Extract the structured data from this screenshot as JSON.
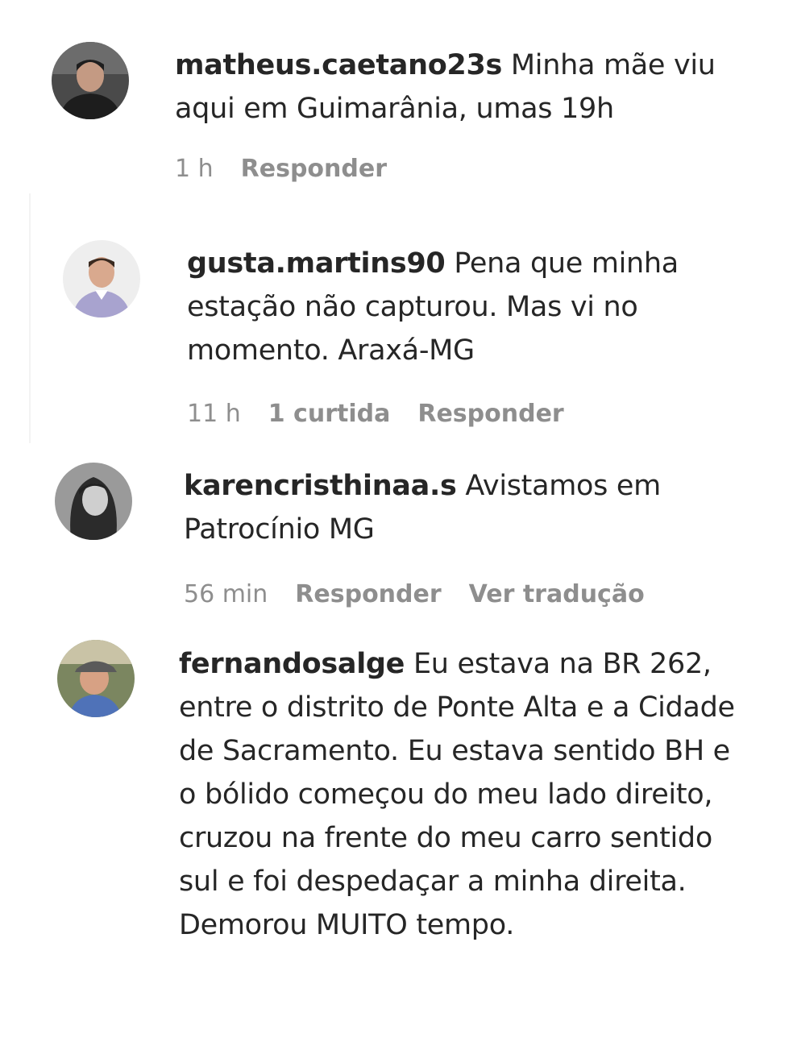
{
  "comments": [
    {
      "username": "matheus.caetano23s",
      "body": "Minha mãe viu aqui em Guimarânia, umas 19h",
      "time": "1 h",
      "reply": "Responder",
      "avatar": "male-dark-avatar"
    },
    {
      "username": "gusta.martins90",
      "body": "Pena que minha estação não capturou. Mas vi no momento. Araxá-MG",
      "time": "11 h",
      "likes": "1 curtida",
      "reply": "Responder",
      "avatar": "male-shirt-avatar"
    },
    {
      "username": "karencristhinaa.s",
      "body": "Avistamos em Patrocínio MG",
      "time": "56 min",
      "reply": "Responder",
      "translate": "Ver tradução",
      "avatar": "female-avatar"
    },
    {
      "username": "fernandosalge",
      "body": "Eu estava na BR 262, entre o distrito de Ponte Alta e a Cidade de Sacramento. Eu estava sentido BH e o bólido começou do meu lado direito, cruzou na frente do meu carro sentido sul e foi despedaçar a minha direita. Demorou MUITO tempo.",
      "avatar": "male-cap-avatar"
    }
  ],
  "colors": {
    "text": "#262626",
    "meta": "#8e8e8e"
  }
}
